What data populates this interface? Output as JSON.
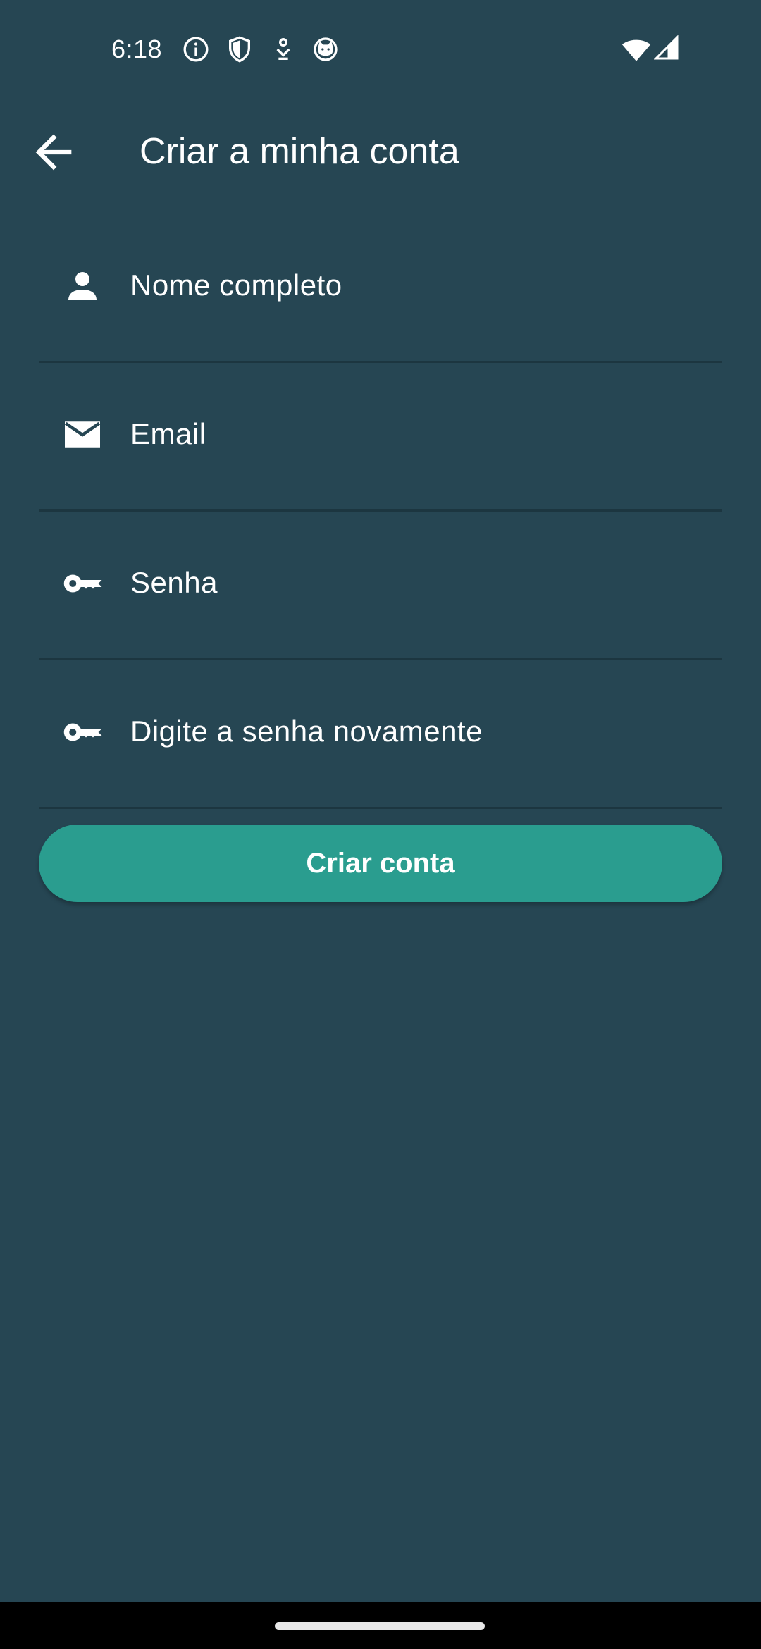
{
  "status_bar": {
    "time": "6:18",
    "icons": [
      "info-icon",
      "shield-icon",
      "download-icon",
      "cat-icon",
      "wifi-icon",
      "signal-icon"
    ]
  },
  "app_bar": {
    "back_icon": "arrow-back-icon",
    "title": "Criar a minha conta"
  },
  "form": {
    "fields": [
      {
        "icon": "person-icon",
        "placeholder": "Nome completo",
        "value": ""
      },
      {
        "icon": "mail-icon",
        "placeholder": "Email",
        "value": ""
      },
      {
        "icon": "key-icon",
        "placeholder": "Senha",
        "value": ""
      },
      {
        "icon": "key-icon",
        "placeholder": "Digite a senha novamente",
        "value": ""
      }
    ],
    "submit_label": "Criar conta"
  },
  "colors": {
    "background": "#264653",
    "accent": "#2a9d8f",
    "text": "#ffffff",
    "divider": "#1c3640",
    "nav_bar": "#000000"
  }
}
